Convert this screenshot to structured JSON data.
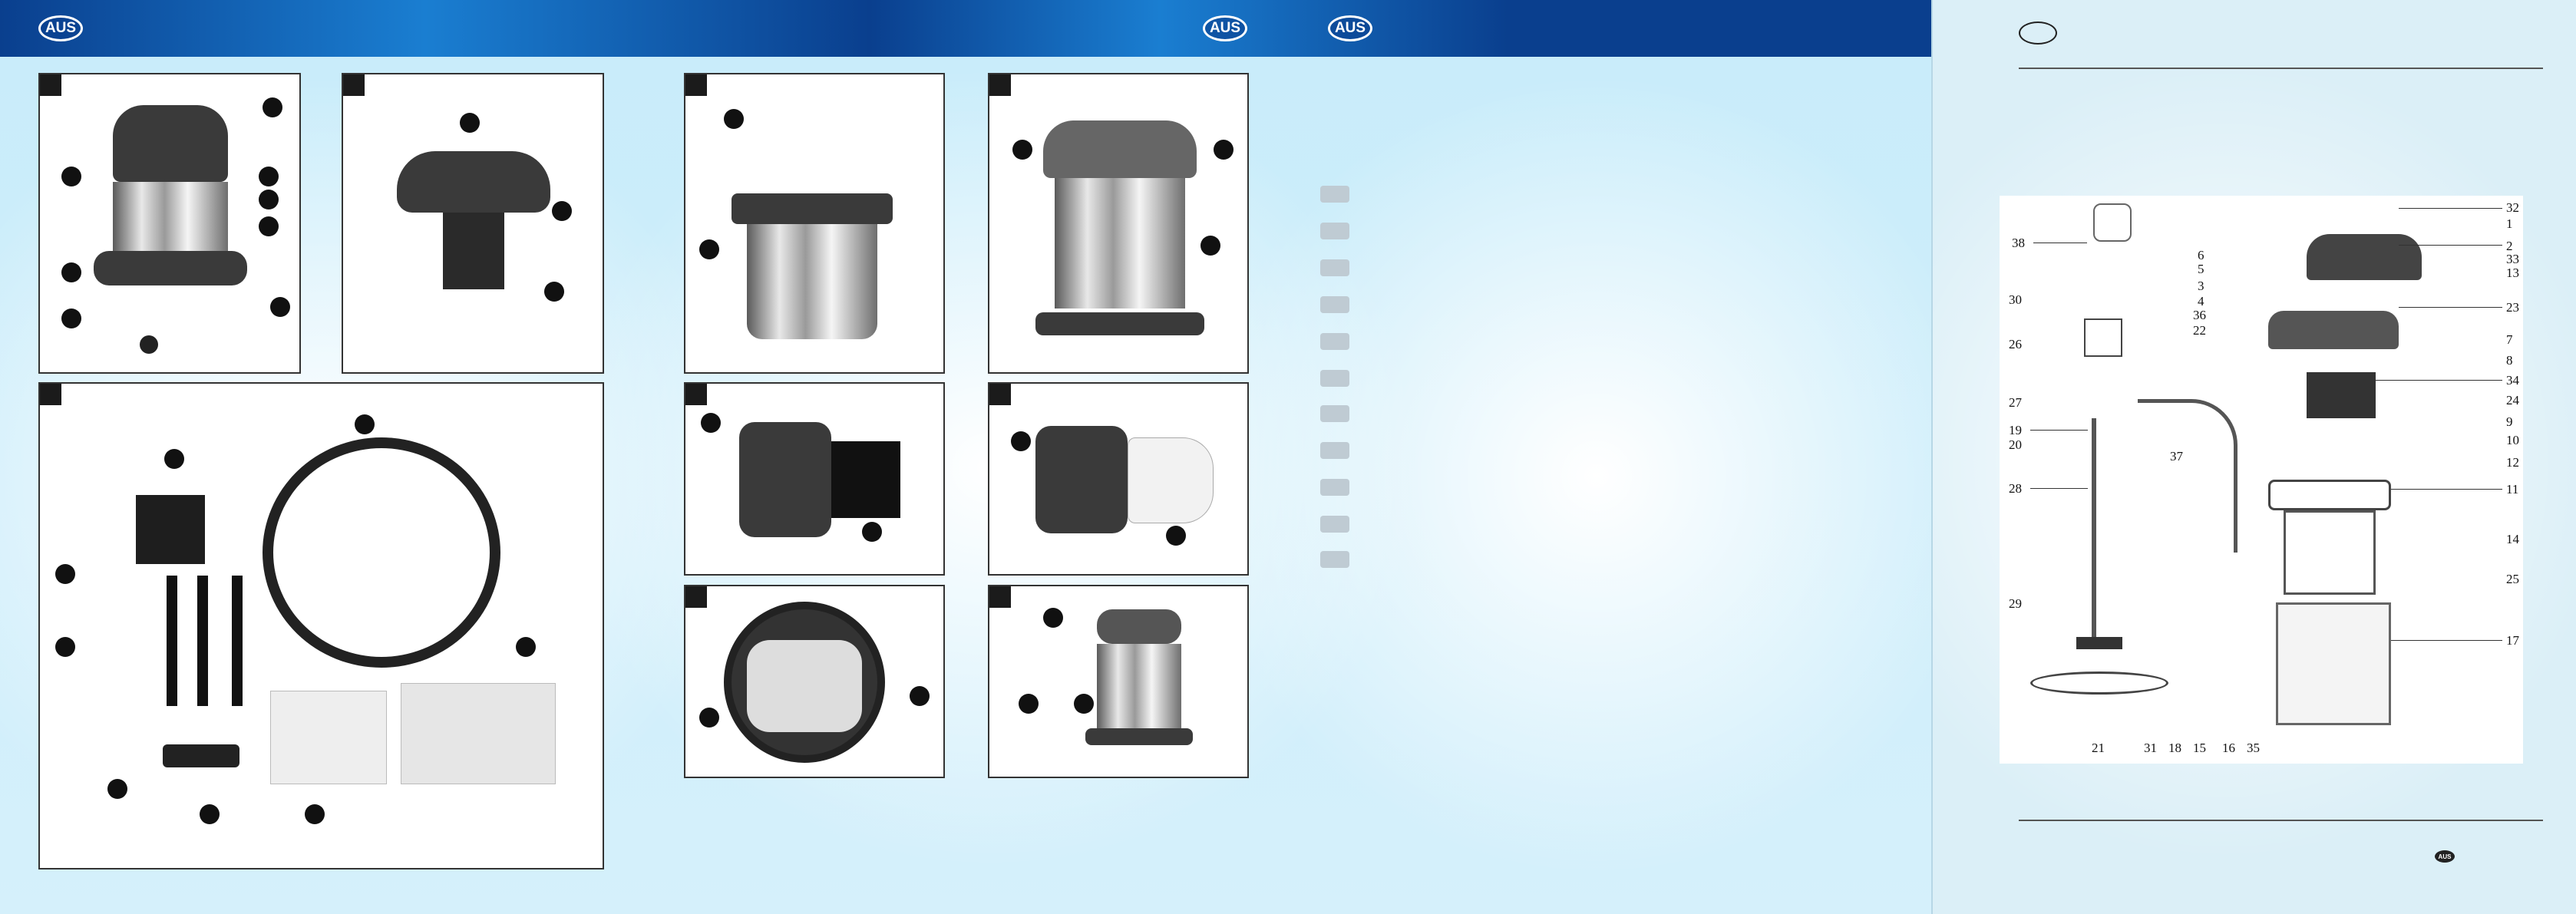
{
  "header": {
    "badge_left": "AUS",
    "badge_middle": "AUS",
    "badge_right": "AUS"
  },
  "toc": {
    "item_count": 11
  },
  "exploded_view": {
    "part_numbers_right": [
      "32",
      "1",
      "2",
      "33",
      "13",
      "23",
      "7",
      "8",
      "34",
      "24",
      "9",
      "10",
      "12",
      "11",
      "14",
      "25",
      "17"
    ],
    "part_numbers_left": [
      "38",
      "6",
      "5",
      "3",
      "4",
      "36",
      "22",
      "30",
      "26",
      "27",
      "19",
      "20",
      "37",
      "28",
      "29"
    ],
    "part_numbers_bottom": [
      "21",
      "31",
      "18",
      "15",
      "16",
      "35"
    ]
  },
  "footer": {
    "badge": "AUS"
  },
  "colors": {
    "banner_dark": "#0a3f8e",
    "banner_light": "#1a7ed1",
    "background": "#d5f0fb"
  }
}
